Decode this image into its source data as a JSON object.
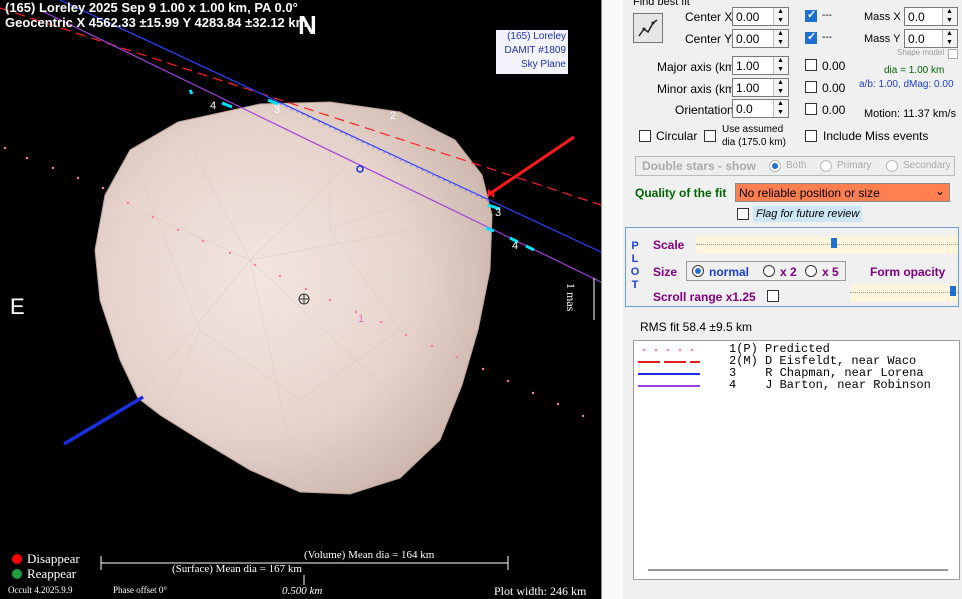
{
  "plot": {
    "title_line1": "(165) Loreley  2025 Sep 9  1.00 x 1.00 km, PA 0.0°",
    "title_line2": "Geocentric  X  4562.33 ±15.99  Y 4283.84 ±32.12 km",
    "north": "N",
    "east": "E",
    "info_box": [
      "(165) Loreley",
      "DAMIT #1809",
      "Sky Plane"
    ],
    "mas_label": "1 mas",
    "chord_labels": [
      "4",
      "3",
      "2",
      "3",
      "4",
      "1"
    ],
    "chord_n_marker": "N",
    "legend_disappear": "Disappear",
    "legend_reappear": "Reappear",
    "volume_dia": "(Volume) Mean dia = 164 km",
    "surface_dia": "(Surface) Mean dia = 167 km",
    "scale_label": "0.500 km",
    "version": "Occult 4.2025.9.9",
    "phase_offset": "Phase offset 0°",
    "plot_width": "Plot width: 246 km",
    "colors": {
      "disappear": "#ff0000",
      "reappear": "#1e9e3c"
    }
  },
  "panel": {
    "find_best_fit": "Find best fit",
    "center_x_label": "Center X",
    "center_x_value": "0.00",
    "center_y_label": "Center Y",
    "center_y_value": "0.00",
    "cx_dashes": "---",
    "cy_dashes": "---",
    "mass_x_label": "Mass X",
    "mass_x_value": "0.0",
    "mass_y_label": "Mass Y",
    "mass_y_value": "0.0",
    "shape_model": "Shape model",
    "major_label": "Major axis (km)",
    "major_value": "1.00",
    "major_fit": "0.00",
    "minor_label": "Minor axis (km)",
    "minor_value": "1.00",
    "minor_fit": "0.00",
    "orient_label": "Orientation",
    "orient_value": "0.0",
    "orient_fit": "0.00",
    "dia": "dia = 1.00 km",
    "ab": "a/b: 1.00, dMag: 0.00",
    "motion": "Motion: 11.37 km/s",
    "circular": "Circular",
    "assumed_dia": "Use assumed",
    "assumed_dia2": "dia (175.0 km)",
    "include_miss": "Include Miss events",
    "double_stars": "Double stars - show",
    "both": "Both",
    "primary": "Primary",
    "secondary": "Secondary",
    "quality_label": "Quality of the fit",
    "quality_value": "No reliable position or size",
    "flag_review": "Flag for future review",
    "plot_letters": [
      "P",
      "L",
      "O",
      "T"
    ],
    "scale": "Scale",
    "size": "Size",
    "size_normal": "normal",
    "size_x2": "x 2",
    "size_x5": "x 5",
    "form_opacity": "Form opacity",
    "scroll_range": "Scroll range x1.25",
    "rms_fit": "RMS fit 58.4 ±9.5 km",
    "legend": [
      {
        "num": "1(P)",
        "name": "Predicted"
      },
      {
        "num": "2(M)",
        "name": "D Eisfeldt, near Waco"
      },
      {
        "num": "3",
        "name": "R Chapman, near Lorena"
      },
      {
        "num": "4",
        "name": "J Barton, near Robinson"
      }
    ],
    "colors": {
      "quality_bg": "#ff7f50",
      "accent": "#1f6fd0",
      "title_green": "#006400",
      "label_purple": "#800080"
    }
  }
}
